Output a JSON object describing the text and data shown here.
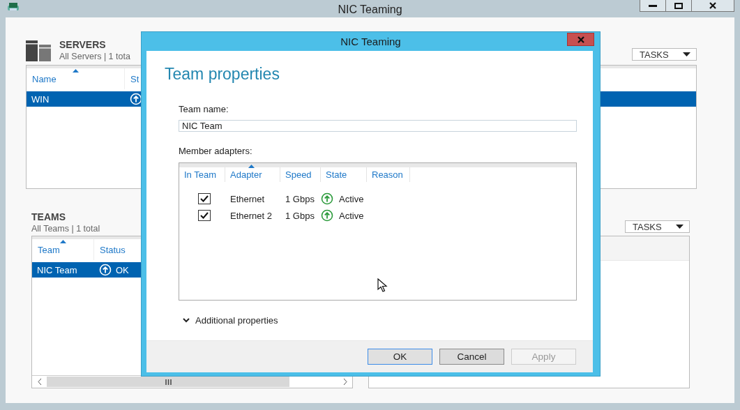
{
  "window": {
    "title": "NIC Teaming"
  },
  "servers": {
    "title": "SERVERS",
    "subtitle": "All Servers | 1 tota",
    "tasks": "TASKS",
    "columns": [
      "Name",
      "St"
    ],
    "rows": [
      {
        "name": "WIN",
        "selected": true
      }
    ]
  },
  "teams": {
    "title": "TEAMS",
    "subtitle": "All Teams | 1 total",
    "tasks": "TASKS",
    "columns": [
      "Team",
      "Status"
    ],
    "rows": [
      {
        "team": "NIC Team",
        "status": "OK",
        "selected": true
      }
    ]
  },
  "dialog": {
    "title": "NIC Teaming",
    "heading": "Team properties",
    "team_name_label": "Team name:",
    "team_name": "NIC Team",
    "members_label": "Member adapters:",
    "columns": [
      "In Team",
      "Adapter",
      "Speed",
      "State",
      "Reason"
    ],
    "adapters": [
      {
        "in_team": true,
        "adapter": "Ethernet",
        "speed": "1 Gbps",
        "state": "Active"
      },
      {
        "in_team": true,
        "adapter": "Ethernet 2",
        "speed": "1 Gbps",
        "state": "Active"
      }
    ],
    "additional": "Additional properties",
    "buttons": [
      {
        "label": "OK",
        "kind": "default"
      },
      {
        "label": "Cancel",
        "kind": "normal"
      },
      {
        "label": "Apply",
        "kind": "disabled"
      }
    ]
  }
}
